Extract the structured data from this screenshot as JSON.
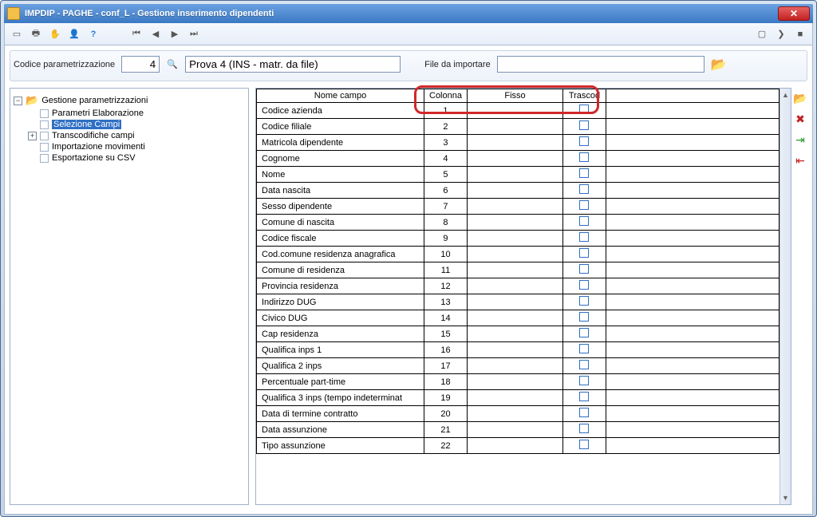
{
  "window": {
    "title": "IMPDIP - PAGHE - conf_L - Gestione inserimento dipendenti"
  },
  "param_bar": {
    "code_label": "Codice parametrizzazione",
    "code_value": "4",
    "desc_value": "Prova 4 (INS - matr. da file)",
    "file_label": "File da importare",
    "file_value": ""
  },
  "tree": {
    "root": "Gestione parametrizzazioni",
    "children": [
      {
        "label": "Parametri Elaborazione",
        "selected": false
      },
      {
        "label": "Selezione Campi",
        "selected": true
      },
      {
        "label": "Transcodifiche campi",
        "selected": false,
        "expandable": true
      }
    ],
    "siblings": [
      {
        "label": "Importazione movimenti"
      },
      {
        "label": "Esportazione su CSV"
      }
    ]
  },
  "grid": {
    "headers": {
      "nome": "Nome campo",
      "colonna": "Colonna",
      "fisso": "Fisso",
      "trascod": "Trascod"
    },
    "rows": [
      {
        "nome": "Codice azienda",
        "colonna": "1"
      },
      {
        "nome": "Codice filiale",
        "colonna": "2"
      },
      {
        "nome": "Matricola dipendente",
        "colonna": "3"
      },
      {
        "nome": "Cognome",
        "colonna": "4"
      },
      {
        "nome": "Nome",
        "colonna": "5"
      },
      {
        "nome": "Data nascita",
        "colonna": "6"
      },
      {
        "nome": "Sesso dipendente",
        "colonna": "7"
      },
      {
        "nome": "Comune di nascita",
        "colonna": "8"
      },
      {
        "nome": "Codice fiscale",
        "colonna": "9"
      },
      {
        "nome": "Cod.comune residenza anagrafica",
        "colonna": "10"
      },
      {
        "nome": "Comune di residenza",
        "colonna": "11"
      },
      {
        "nome": "Provincia residenza",
        "colonna": "12"
      },
      {
        "nome": "Indirizzo DUG",
        "colonna": "13"
      },
      {
        "nome": "Civico DUG",
        "colonna": "14"
      },
      {
        "nome": "Cap residenza",
        "colonna": "15"
      },
      {
        "nome": "Qualifica inps 1",
        "colonna": "16"
      },
      {
        "nome": "Qualifica 2 inps",
        "colonna": "17"
      },
      {
        "nome": "Percentuale part-time",
        "colonna": "18"
      },
      {
        "nome": "Qualifica 3 inps (tempo indeterminat",
        "colonna": "19"
      },
      {
        "nome": "Data di termine contratto",
        "colonna": "20"
      },
      {
        "nome": "Data assunzione",
        "colonna": "21"
      },
      {
        "nome": "Tipo assunzione",
        "colonna": "22"
      }
    ]
  }
}
